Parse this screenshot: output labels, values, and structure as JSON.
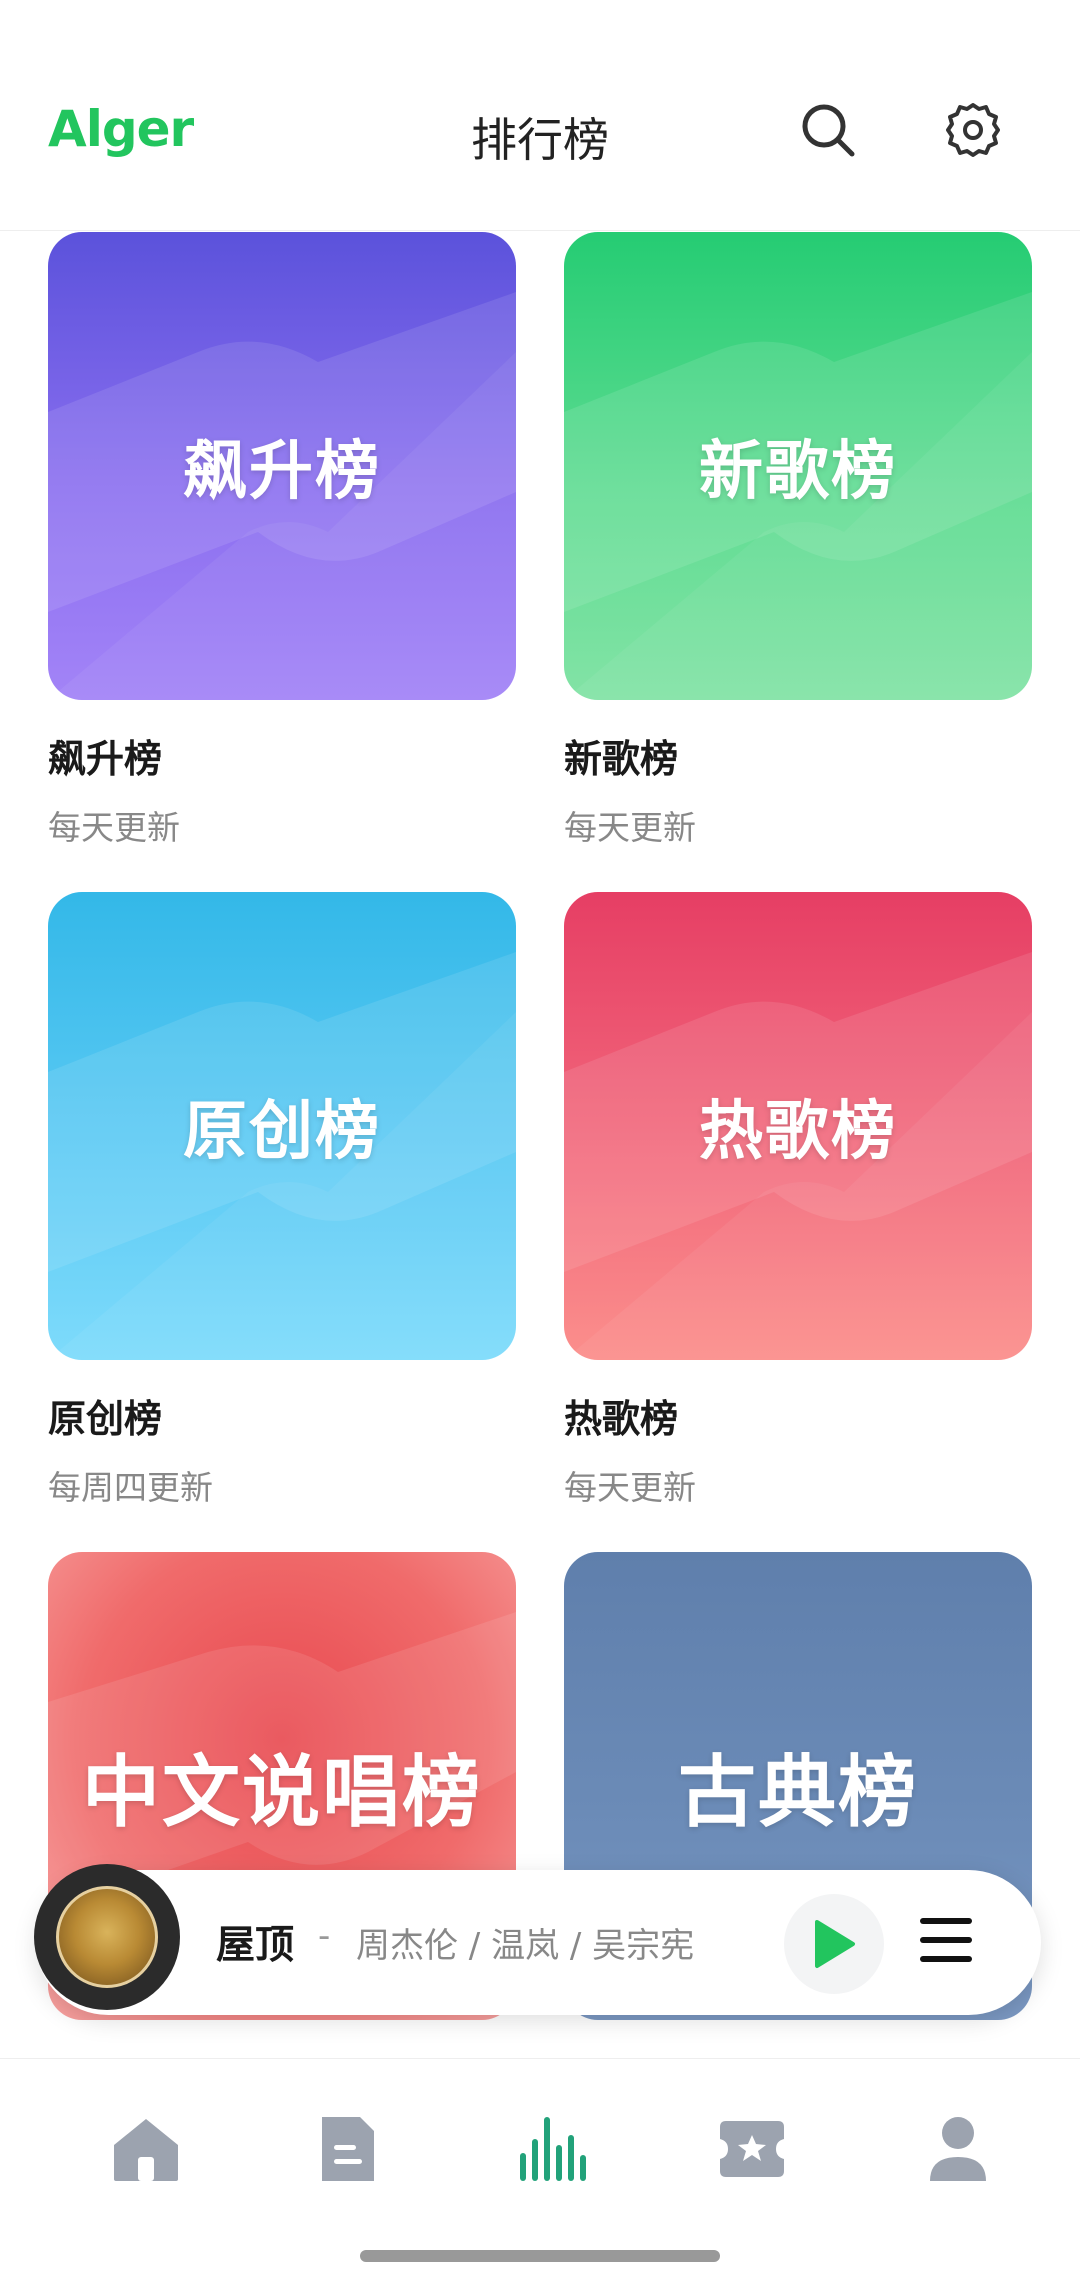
{
  "header": {
    "brand": "Alger",
    "title": "排行榜"
  },
  "charts": [
    {
      "cover": "飙升榜",
      "name": "飙升榜",
      "update": "每天更新"
    },
    {
      "cover": "新歌榜",
      "name": "新歌榜",
      "update": "每天更新"
    },
    {
      "cover": "原创榜",
      "name": "原创榜",
      "update": "每周四更新"
    },
    {
      "cover": "热歌榜",
      "name": "热歌榜",
      "update": "每天更新"
    },
    {
      "cover": "中文说唱榜"
    },
    {
      "cover": "古典榜"
    }
  ],
  "player": {
    "song": "屋顶",
    "separator": "-",
    "artist": "周杰伦 / 温岚 / 吴宗宪"
  },
  "icons": {
    "header": [
      "search-icon",
      "settings-gear-icon"
    ],
    "player": [
      "album-disc-icon",
      "play-icon",
      "playlist-menu-icon"
    ],
    "tabs": [
      "home-icon",
      "document-icon",
      "chart-bars-icon",
      "ticket-star-icon",
      "user-icon"
    ]
  },
  "colors": {
    "brand": "#22c55e",
    "active_tab": "#22a27a",
    "inactive_tab": "#9ca3af"
  }
}
